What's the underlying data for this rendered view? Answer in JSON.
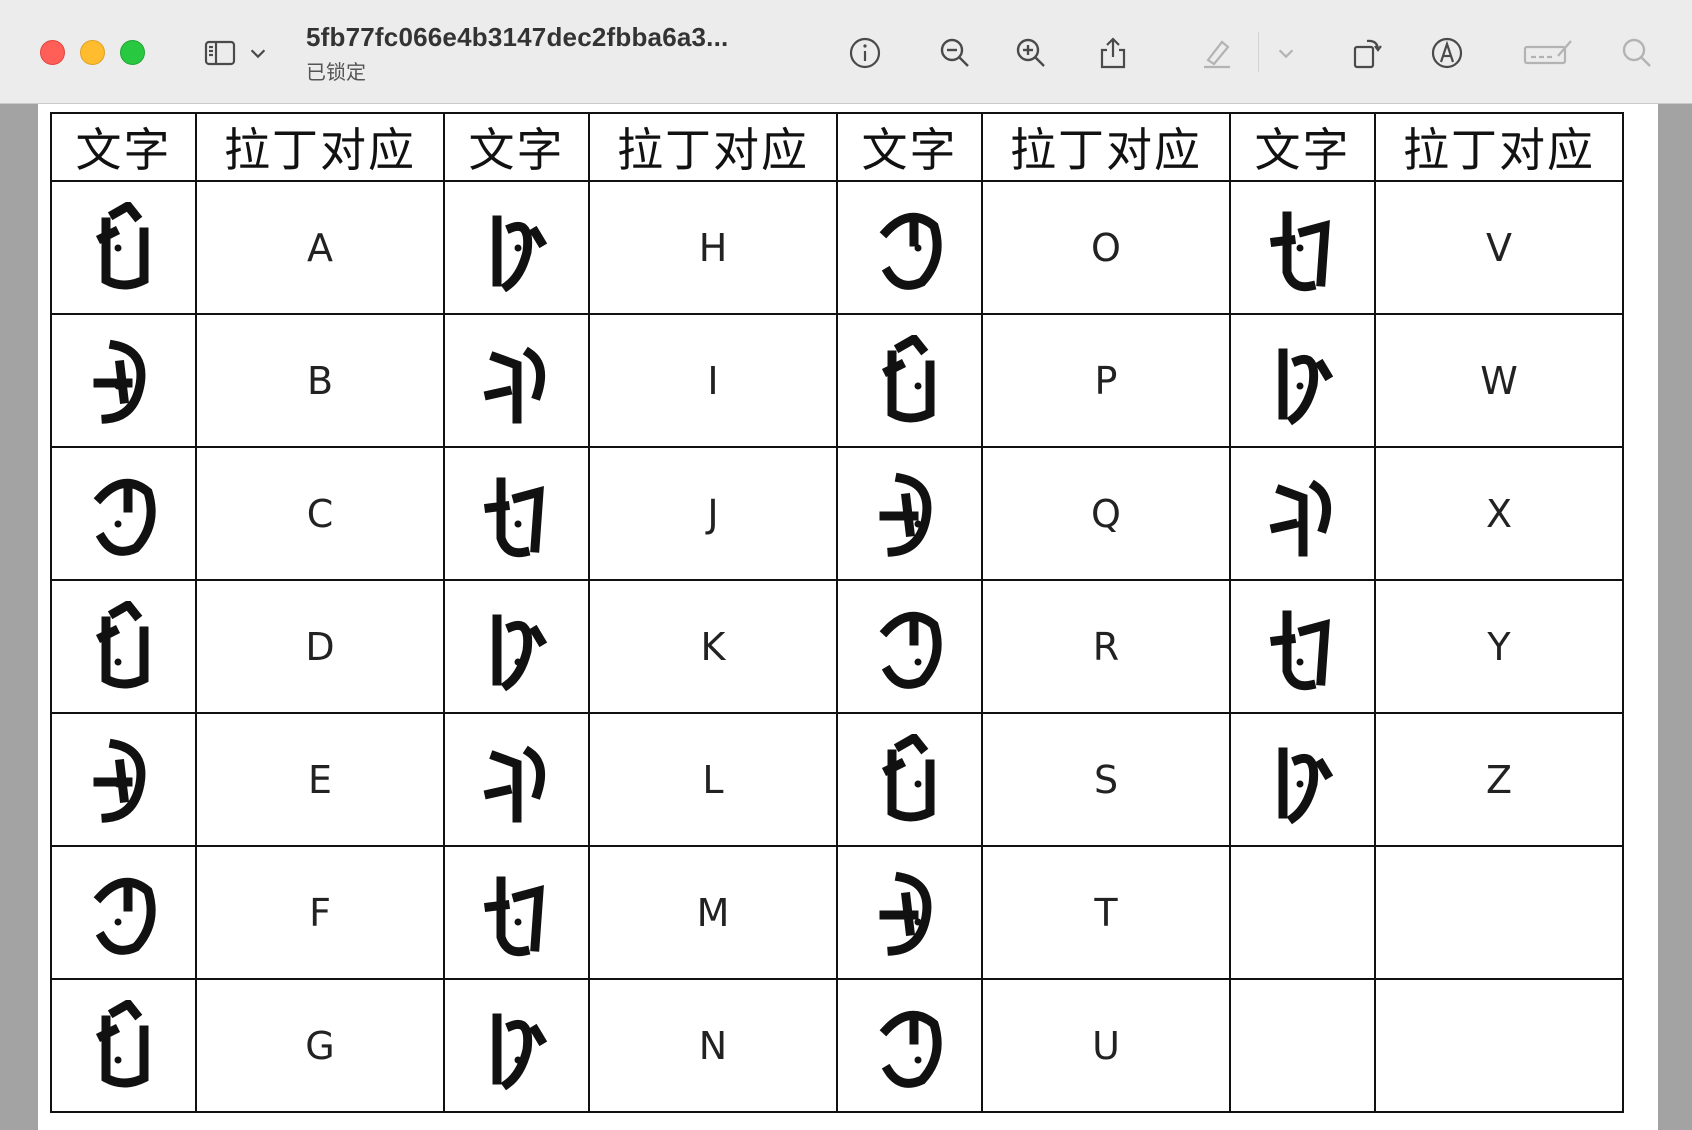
{
  "titlebar": {
    "document_title": "5fb77fc066e4b3147dec2fbba6a3...",
    "status": "已锁定",
    "icons": [
      "sidebar-icon",
      "chevron-down-icon",
      "info-icon",
      "zoom-out-icon",
      "zoom-in-icon",
      "share-icon",
      "highlighter-icon",
      "chevron-down-icon",
      "rotate-icon",
      "markup-icon",
      "signature-icon",
      "search-icon"
    ]
  },
  "table": {
    "headers": [
      "文字",
      "拉丁对应",
      "文字",
      "拉丁对应",
      "文字",
      "拉丁对应",
      "文字",
      "拉丁对应"
    ],
    "rows": [
      [
        "A",
        "H",
        "O",
        "V"
      ],
      [
        "B",
        "I",
        "P",
        "W"
      ],
      [
        "C",
        "J",
        "Q",
        "X"
      ],
      [
        "D",
        "K",
        "R",
        "Y"
      ],
      [
        "E",
        "L",
        "S",
        "Z"
      ],
      [
        "F",
        "M",
        "T",
        ""
      ],
      [
        "G",
        "N",
        "U",
        ""
      ]
    ]
  }
}
